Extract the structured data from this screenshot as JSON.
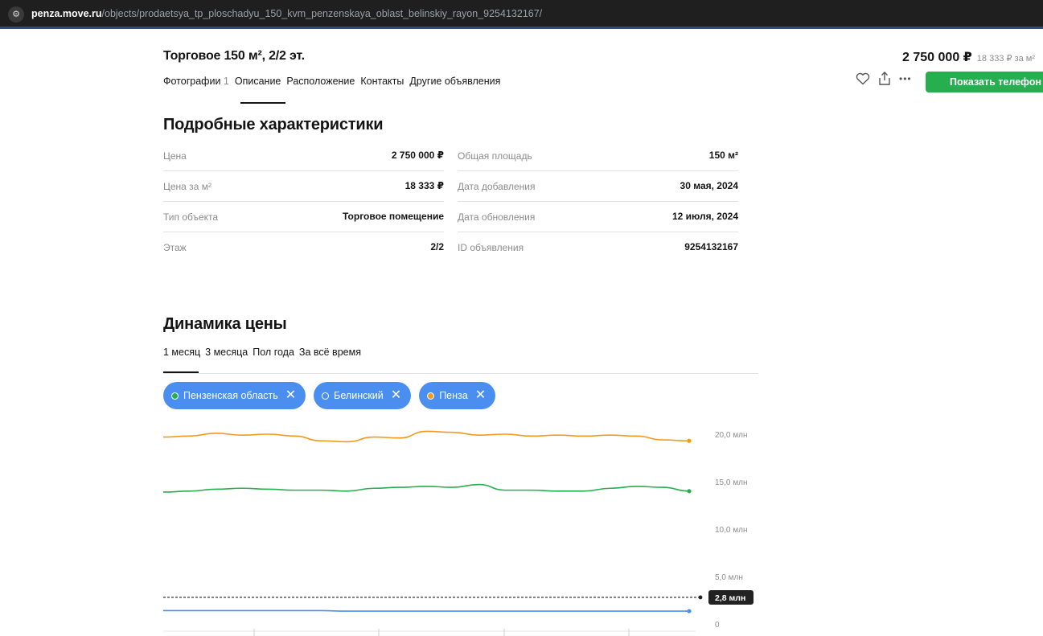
{
  "browser": {
    "url_host": "penza.move.ru",
    "url_path": "/objects/prodaetsya_tp_ploschadyu_150_kvm_penzenskaya_oblast_belinskiy_rayon_9254132167/"
  },
  "header": {
    "title": "Торговое 150 м², 2/2 эт.",
    "price": "2 750 000 ₽",
    "price_per_m2": "18 333 ₽ за м²",
    "nav": [
      {
        "label": "Фотографии",
        "count": "1"
      },
      {
        "label": "Описание",
        "count": ""
      },
      {
        "label": "Расположение",
        "count": ""
      },
      {
        "label": "Контакты",
        "count": ""
      },
      {
        "label": "Другие объявления",
        "count": ""
      }
    ],
    "active_nav": "Описание",
    "show_phone_label": "Показать телефон",
    "more_label": "•••"
  },
  "specs": {
    "title": "Подробные характеристики",
    "left": [
      {
        "key": "Цена",
        "value": "2 750 000 ₽"
      },
      {
        "key": "Цена за м²",
        "value": "18 333 ₽"
      },
      {
        "key": "Тип объекта",
        "value": "Торговое помещение"
      },
      {
        "key": "Этаж",
        "value": "2/2"
      }
    ],
    "right": [
      {
        "key": "Общая площадь",
        "value": "150 м²"
      },
      {
        "key": "Дата добавления",
        "value": "30 мая, 2024"
      },
      {
        "key": "Дата обновления",
        "value": "12 июля, 2024"
      },
      {
        "key": "ID объявления",
        "value": "9254132167"
      }
    ]
  },
  "dynamics": {
    "title": "Динамика цены",
    "tabs": [
      "1 месяц",
      "3 месяца",
      "Пол года",
      "За всё время"
    ],
    "active_tab": "1 месяц",
    "chips": [
      {
        "label": "Пензенская область",
        "dot_color": "#27ae4f"
      },
      {
        "label": "Белинский",
        "dot_color": "#4a8ff0"
      },
      {
        "label": "Пенза",
        "dot_color": "#f39a1e"
      }
    ]
  },
  "chart_data": {
    "type": "line",
    "ylim": [
      0,
      22
    ],
    "y_ticks": [
      {
        "value": 20,
        "label": "20,0 млн"
      },
      {
        "value": 15,
        "label": "15,0 млн"
      },
      {
        "value": 10,
        "label": "10,0 млн"
      },
      {
        "value": 5,
        "label": "5,0 млн"
      },
      {
        "value": 0,
        "label": "0"
      }
    ],
    "current_value": {
      "value": 2.8,
      "label": "2,8 млн"
    },
    "series": [
      {
        "name": "Пенза",
        "color": "#f39a1e",
        "values": [
          19.7,
          19.8,
          20.1,
          19.9,
          20.0,
          19.8,
          19.3,
          19.2,
          19.7,
          19.6,
          20.3,
          20.2,
          19.9,
          20.0,
          19.8,
          19.9,
          19.8,
          19.9,
          19.8,
          19.4,
          19.3
        ]
      },
      {
        "name": "Пензенская область",
        "color": "#27ae4f",
        "values": [
          13.9,
          14.0,
          14.2,
          14.3,
          14.2,
          14.1,
          14.1,
          14.0,
          14.3,
          14.4,
          14.5,
          14.4,
          14.7,
          14.1,
          14.1,
          14.0,
          14.0,
          14.3,
          14.5,
          14.4,
          14.0
        ]
      },
      {
        "name": "Белинский",
        "color": "#4a8ff0",
        "values": [
          1.4,
          1.4,
          1.4,
          1.4,
          1.4,
          1.4,
          1.4,
          1.35,
          1.35,
          1.35,
          1.35,
          1.35,
          1.35,
          1.35,
          1.35,
          1.35,
          1.35,
          1.35,
          1.35,
          1.35,
          1.35
        ]
      }
    ]
  }
}
